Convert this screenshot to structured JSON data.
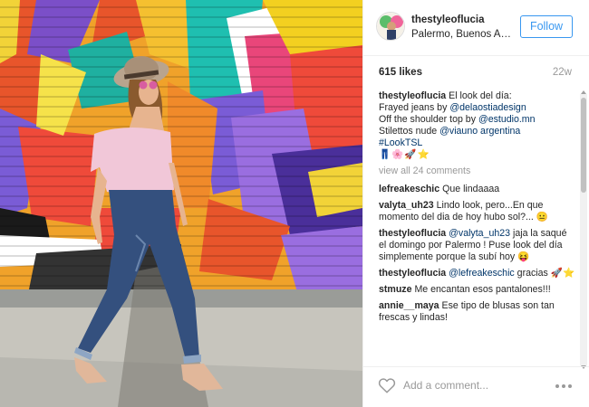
{
  "post": {
    "username": "thestyleoflucia",
    "location": "Palermo, Buenos Aires",
    "follow_label": "Follow",
    "likes": "615 likes",
    "time_ago": "22w"
  },
  "caption": {
    "username": "thestyleoflucia",
    "line1": "El look del día:",
    "line2": "Frayed jeans by ",
    "mention1": "@delaostiadesign",
    "line3": "Off the shoulder top by ",
    "mention2": "@estudio.mn",
    "line4": "Stilettos nude ",
    "mention3": "@viauno argentina",
    "hashtag": "#LookTSL",
    "emojis": "👖🌸🚀⭐"
  },
  "view_all": "view all 24 comments",
  "comments": [
    {
      "user": "lefreakeschic",
      "text": "Que lindaaaa"
    },
    {
      "user": "valyta_uh23",
      "text": "Lindo look, pero...En que momento del dia de hoy hubo sol?... 😐"
    },
    {
      "user": "thestyleoflucia",
      "mention": "@valyta_uh23",
      "text": " jaja la saqué el domingo por Palermo ! Puse look del día simplemente porque la subí hoy 😝"
    },
    {
      "user": "thestyleoflucia",
      "mention": "@lefreakeschic",
      "text": " gracias 🚀⭐"
    },
    {
      "user": "stmuze",
      "text": "Me encantan esos pantalones!!!"
    },
    {
      "user": "annie__maya",
      "text": "Ese tipo de blusas son tan frescas y lindas!"
    }
  ],
  "footer": {
    "placeholder": "Add a comment..."
  },
  "colors": {
    "accent": "#3897f0",
    "link": "#003569",
    "muted": "#999999"
  },
  "icons": [
    "heart-icon",
    "more-options-icon"
  ]
}
